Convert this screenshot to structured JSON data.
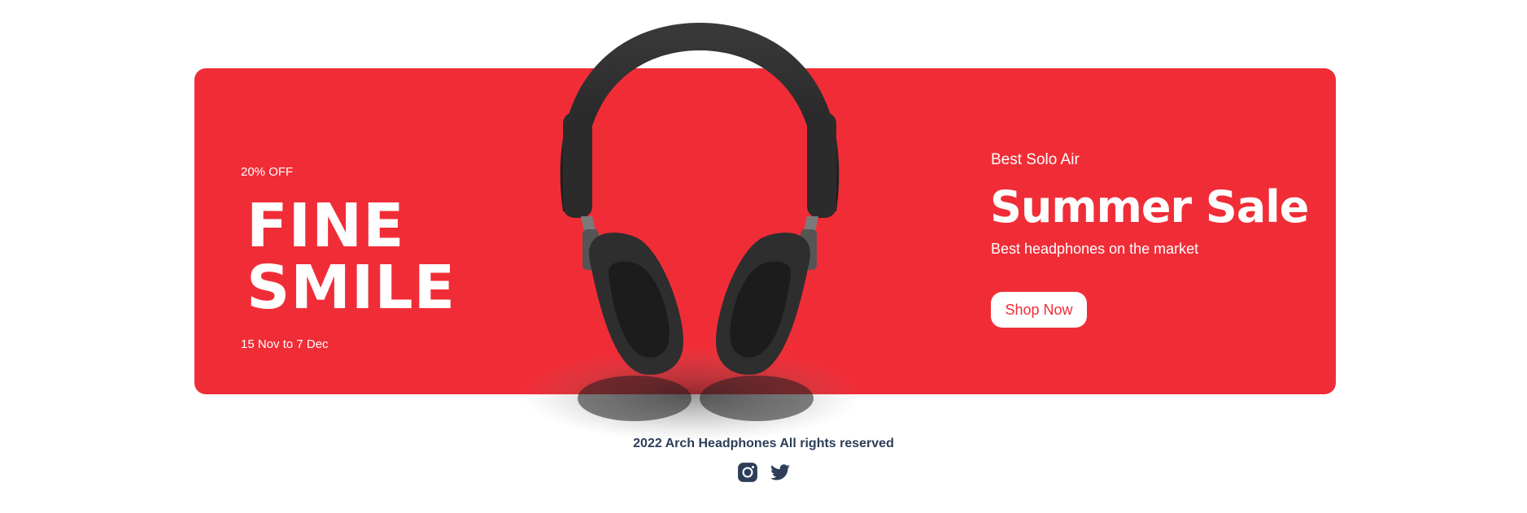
{
  "banner": {
    "discount": "20% OFF",
    "large_text_1": "FINE",
    "large_text_2": "SMILE",
    "sale_time": "15 Nov to 7 Dec",
    "small_text": "Best Solo Air",
    "mid_text": "Summer Sale",
    "desc": "Best headphones on the market",
    "button_label": "Shop Now",
    "background_color": "#f02d37",
    "product_image": "headphones-image"
  },
  "footer": {
    "copyright": "2022 Arch Headphones All rights reserved",
    "icons": [
      "instagram-icon",
      "twitter-icon"
    ],
    "text_color": "#2d3e56"
  }
}
